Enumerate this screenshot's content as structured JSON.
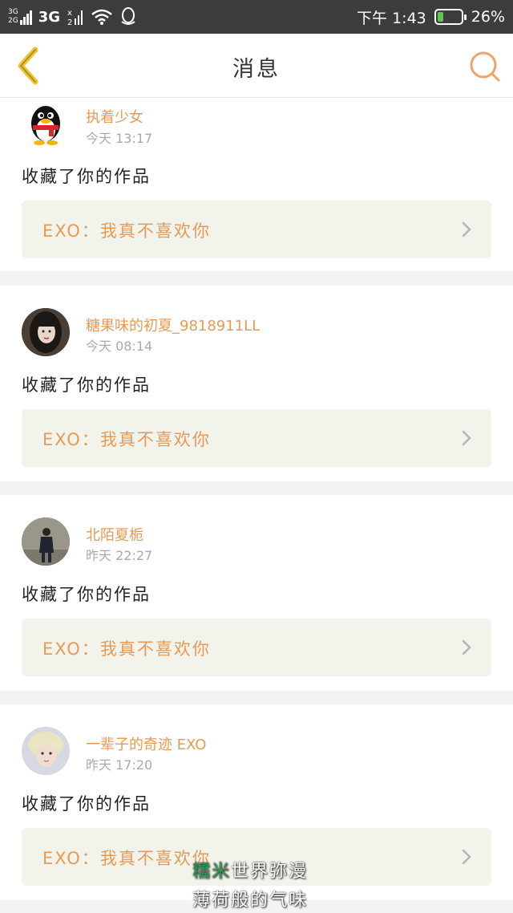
{
  "colors": {
    "accent": "#e59a55",
    "status_bg": "#3c3c3c",
    "battery": "#5ec84e",
    "link_bg": "#f2f3ea",
    "back_arrow": "#f2c530"
  },
  "status_bar": {
    "sim1": "3G",
    "sim2": "2G",
    "network": "3G",
    "time": "下午 1:43",
    "battery_percent": "26%",
    "battery_level": 0.26,
    "icons": [
      "signal-icon",
      "data-arrows-icon",
      "wifi-icon",
      "qq-icon",
      "battery-icon"
    ]
  },
  "header": {
    "title": "消息",
    "back_icon": "back-chevron-icon",
    "search_icon": "search-icon"
  },
  "messages": [
    {
      "username": "执着少女",
      "time": "今天 13:17",
      "action": "收藏了你的作品",
      "work": "EXO：我真不喜欢你",
      "avatar": "qq-penguin-avatar"
    },
    {
      "username": "糖果味的初夏_9818911LL",
      "time": "今天 08:14",
      "action": "收藏了你的作品",
      "work": "EXO：我真不喜欢你",
      "avatar": "girl-portrait-avatar"
    },
    {
      "username": "北陌夏栀",
      "time": "昨天 22:27",
      "action": "收藏了你的作品",
      "work": "EXO：我真不喜欢你",
      "avatar": "standing-person-avatar"
    },
    {
      "username": "一辈子的奇迹 EXO",
      "time": "昨天 17:20",
      "action": "收藏了你的作品",
      "work": "EXO：我真不喜欢你",
      "avatar": "blonde-boy-avatar"
    }
  ],
  "watermark": {
    "line1_green": "糯米",
    "line1_rest": "世界弥漫",
    "line2": "薄荷般的气味"
  }
}
